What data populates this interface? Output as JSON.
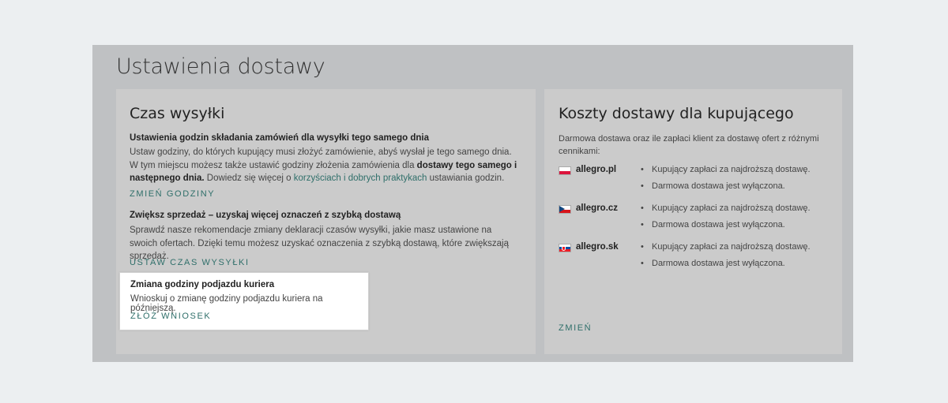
{
  "page": {
    "title": "Ustawienia dostawy"
  },
  "left_card": {
    "title": "Czas wysyłki",
    "section1": {
      "heading": "Ustawienia godzin składania zamówień dla wysyłki tego samego dnia",
      "body_line1": "Ustaw godziny, do których kupujący musi złożyć zamówienie, abyś wysłał je tego samego dnia. W tym miejscu możesz także ustawić godziny złożenia zamówienia dla ",
      "body_bold": "dostawy tego samego i następnego dnia.",
      "body_line2": " Dowiedz się więcej o ",
      "body_link": "korzyściach i dobrych praktykach",
      "body_line3": " ustawiania godzin.",
      "action": "ZMIEŃ GODZINY"
    },
    "section2": {
      "heading": "Zwiększ sprzedaż – uzyskaj więcej oznaczeń z szybką dostawą",
      "body": "Sprawdź nasze rekomendacje zmiany deklaracji czasów wysyłki, jakie masz ustawione na swoich ofertach. Dzięki temu możesz uzyskać oznaczenia z szybką dostawą, które zwiększają sprzedaż.",
      "action": "USTAW CZAS WYSYŁKI"
    },
    "section3": {
      "heading": "Zmiana godziny podjazdu kuriera",
      "body": "Wnioskuj o zmianę godziny podjazdu kuriera na późniejszą.",
      "action": "ZŁÓŻ WNIOSEK"
    }
  },
  "right_card": {
    "title": "Koszty dostawy dla kupującego",
    "intro": "Darmowa dostawa oraz ile zapłaci klient za dostawę ofert z różnymi cennikami:",
    "markets": [
      {
        "name": "allegro.pl",
        "flag": "poland-flag-icon",
        "items": [
          "Kupujący zapłaci za najdroższą dostawę.",
          "Darmowa dostawa jest wyłączona."
        ]
      },
      {
        "name": "allegro.cz",
        "flag": "czech-flag-icon",
        "items": [
          "Kupujący zapłaci za najdroższą dostawę.",
          "Darmowa dostawa jest wyłączona."
        ]
      },
      {
        "name": "allegro.sk",
        "flag": "slovakia-flag-icon",
        "items": [
          "Kupujący zapłaci za najdroższą dostawę.",
          "Darmowa dostawa jest wyłączona."
        ]
      }
    ],
    "action": "ZMIEŃ"
  },
  "colors": {
    "accent": "#2f6f6a",
    "overlay": "#bfc1c3",
    "card": "#cbcbcb",
    "background": "#eceff1"
  }
}
